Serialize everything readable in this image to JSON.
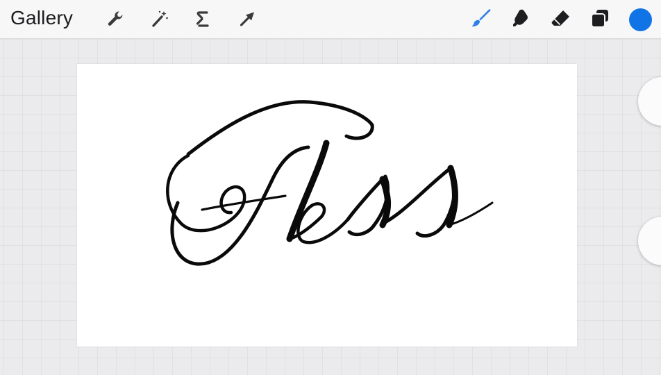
{
  "toolbar": {
    "gallery_label": "Gallery",
    "left_tools": [
      {
        "icon": "wrench-icon",
        "name": "actions"
      },
      {
        "icon": "magic-wand-icon",
        "name": "adjustments"
      },
      {
        "icon": "selection-s-icon",
        "name": "selection"
      },
      {
        "icon": "arrow-cursor-icon",
        "name": "transform"
      }
    ],
    "right_tools": [
      {
        "icon": "brush-icon",
        "name": "paint",
        "active": true
      },
      {
        "icon": "smudge-finger-icon",
        "name": "smudge"
      },
      {
        "icon": "eraser-icon",
        "name": "erase"
      },
      {
        "icon": "layers-icon",
        "name": "layers"
      }
    ],
    "active_tool_color": "#2f80e8",
    "current_color": "#1174e6"
  },
  "canvas": {
    "artwork_text": "Tess",
    "ink_color": "#0a0a0a",
    "background": "#ffffff"
  },
  "sidebar": {
    "controls": [
      {
        "name": "brush-size-slider-handle"
      },
      {
        "name": "opacity-slider-handle"
      }
    ]
  }
}
